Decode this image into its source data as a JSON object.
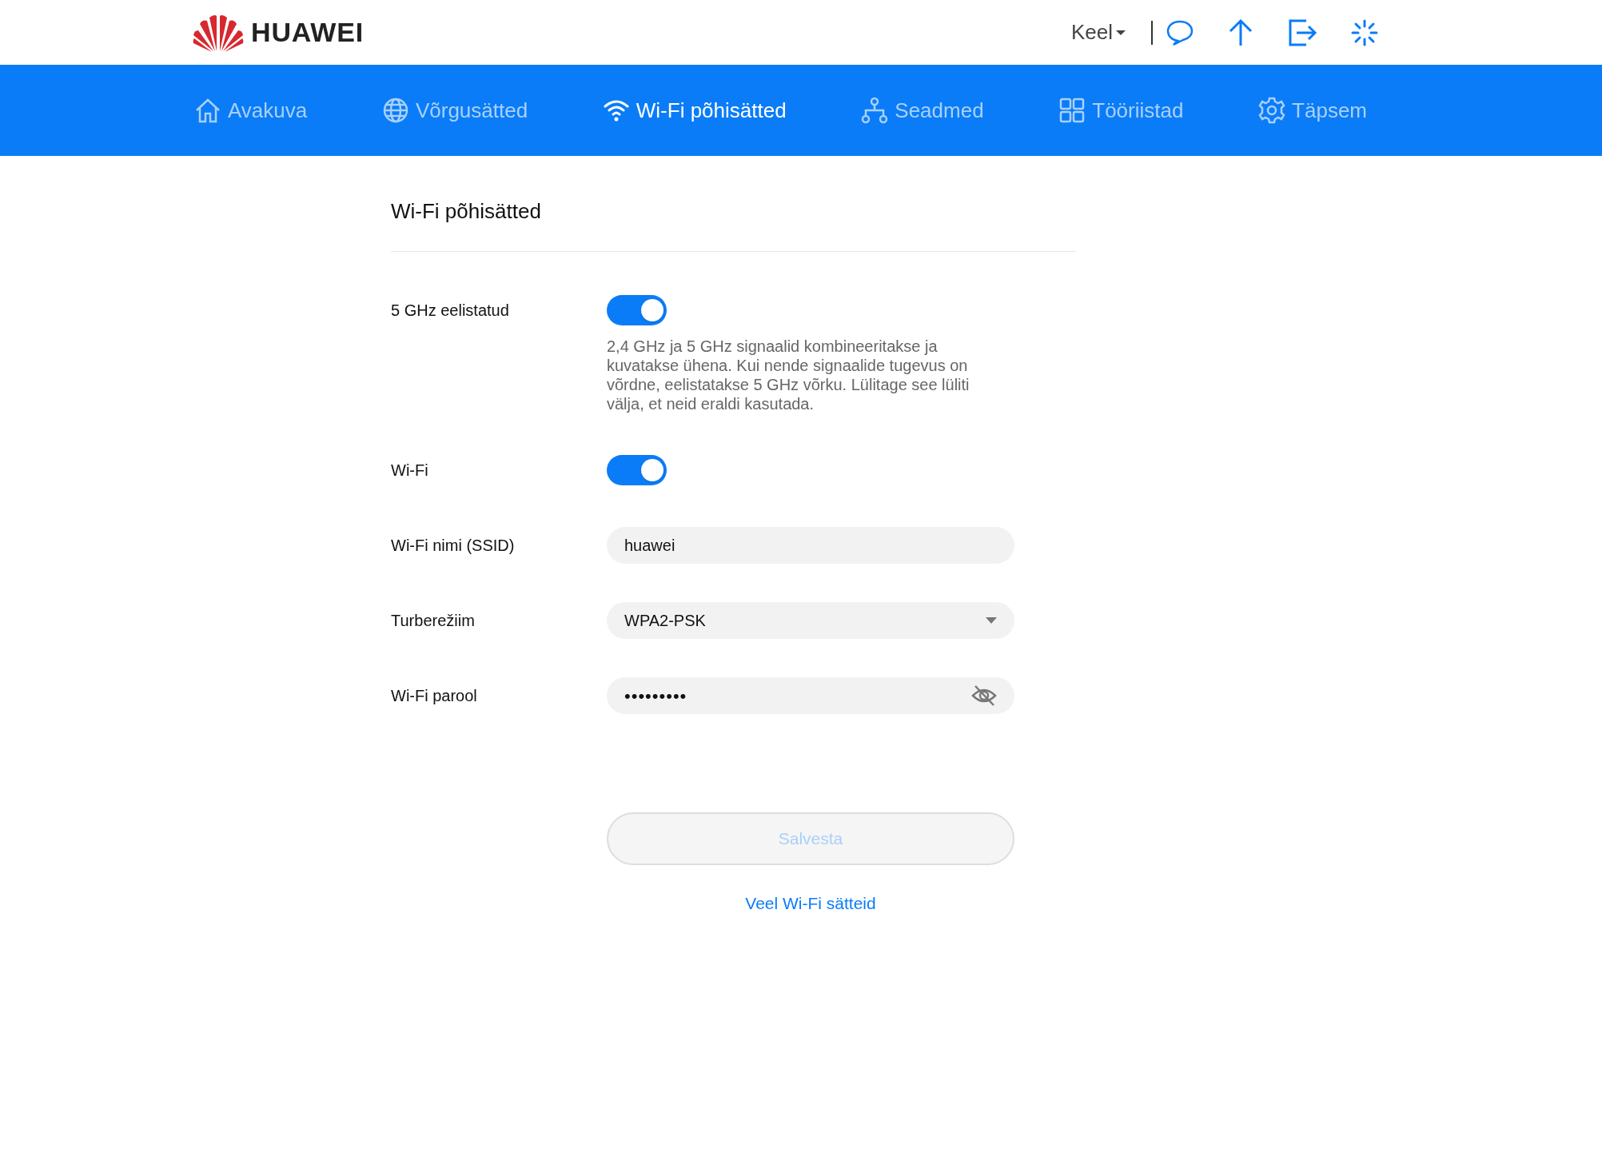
{
  "header": {
    "logo_text": "HUAWEI",
    "language": "Keel"
  },
  "nav": [
    {
      "label": "Avakuva",
      "selected": false
    },
    {
      "label": "Võrgusätted",
      "selected": false
    },
    {
      "label": "Wi-Fi põhisätted",
      "selected": true
    },
    {
      "label": "Seadmed",
      "selected": false
    },
    {
      "label": "Tööriistad",
      "selected": false
    },
    {
      "label": "Täpsem",
      "selected": false
    }
  ],
  "page_title": "Wi-Fi põhisätted",
  "settings": [
    {
      "kind": "toggle",
      "label": "5 GHz eelistatud",
      "on": true,
      "description": "2,4 GHz ja 5 GHz signaalid kombineeritakse ja kuvatakse ühena. Kui nende signaalide tugevus on võrdne, eelistatakse 5 GHz võrku. Lülitage see lüliti välja, et neid eraldi kasutada."
    },
    {
      "kind": "toggle",
      "label": "Wi-Fi",
      "on": true
    },
    {
      "kind": "text",
      "label": "Wi-Fi nimi (SSID)",
      "value": "huawei"
    },
    {
      "kind": "select",
      "label": "Turberežiim",
      "value": "WPA2-PSK"
    },
    {
      "kind": "password",
      "label": "Wi-Fi parool",
      "value": "•••••••••"
    }
  ],
  "save_button": {
    "label": "Salvesta",
    "disabled": true
  },
  "more_link": "Veel Wi-Fi sätteid"
}
